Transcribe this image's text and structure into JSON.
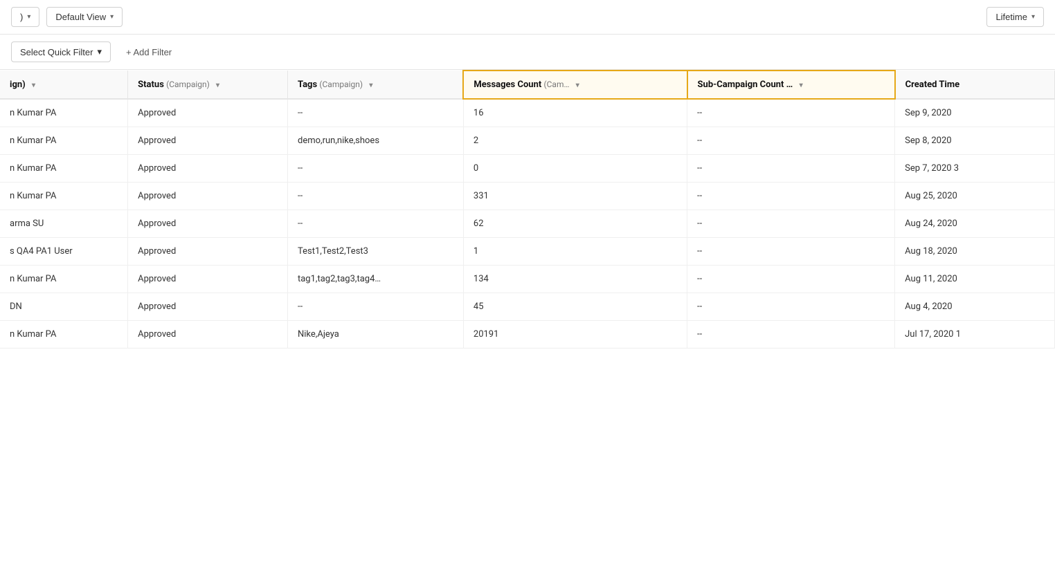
{
  "toolbar": {
    "default_view_label": "Default View",
    "lifetime_label": "Lifetime",
    "chevron": "▾"
  },
  "filter_bar": {
    "quick_filter_label": "Select Quick Filter",
    "add_filter_label": "+ Add Filter"
  },
  "table": {
    "columns": [
      {
        "id": "name",
        "label": "ign)",
        "sub": "",
        "highlighted": false
      },
      {
        "id": "status",
        "label": "Status",
        "sub": "(Campaign)",
        "highlighted": false
      },
      {
        "id": "tags",
        "label": "Tags",
        "sub": "(Campaign)",
        "highlighted": false
      },
      {
        "id": "messages_count",
        "label": "Messages Count",
        "sub": "(Cam…",
        "highlighted": true
      },
      {
        "id": "subcampaign_count",
        "label": "Sub-Campaign Count …",
        "sub": "",
        "highlighted": true
      },
      {
        "id": "created_time",
        "label": "Created Time",
        "sub": "",
        "highlighted": false
      }
    ],
    "rows": [
      {
        "name": "n Kumar PA",
        "status": "Approved",
        "tags": "--",
        "messages_count": "16",
        "subcampaign_count": "--",
        "created_time": "Sep 9, 2020"
      },
      {
        "name": "n Kumar PA",
        "status": "Approved",
        "tags": "demo,run,nike,shoes",
        "messages_count": "2",
        "subcampaign_count": "--",
        "created_time": "Sep 8, 2020"
      },
      {
        "name": "n Kumar PA",
        "status": "Approved",
        "tags": "--",
        "messages_count": "0",
        "subcampaign_count": "--",
        "created_time": "Sep 7, 2020 3"
      },
      {
        "name": "n Kumar PA",
        "status": "Approved",
        "tags": "--",
        "messages_count": "331",
        "subcampaign_count": "--",
        "created_time": "Aug 25, 2020"
      },
      {
        "name": "arma SU",
        "status": "Approved",
        "tags": "--",
        "messages_count": "62",
        "subcampaign_count": "--",
        "created_time": "Aug 24, 2020"
      },
      {
        "name": "s QA4 PA1 User",
        "status": "Approved",
        "tags": "Test1,Test2,Test3",
        "messages_count": "1",
        "subcampaign_count": "--",
        "created_time": "Aug 18, 2020"
      },
      {
        "name": "n Kumar PA",
        "status": "Approved",
        "tags": "tag1,tag2,tag3,tag4…",
        "messages_count": "134",
        "subcampaign_count": "--",
        "created_time": "Aug 11, 2020"
      },
      {
        "name": "DN",
        "status": "Approved",
        "tags": "--",
        "messages_count": "45",
        "subcampaign_count": "--",
        "created_time": "Aug 4, 2020"
      },
      {
        "name": "n Kumar PA",
        "status": "Approved",
        "tags": "Nike,Ajeya",
        "messages_count": "20191",
        "subcampaign_count": "--",
        "created_time": "Jul 17, 2020 1"
      }
    ]
  }
}
